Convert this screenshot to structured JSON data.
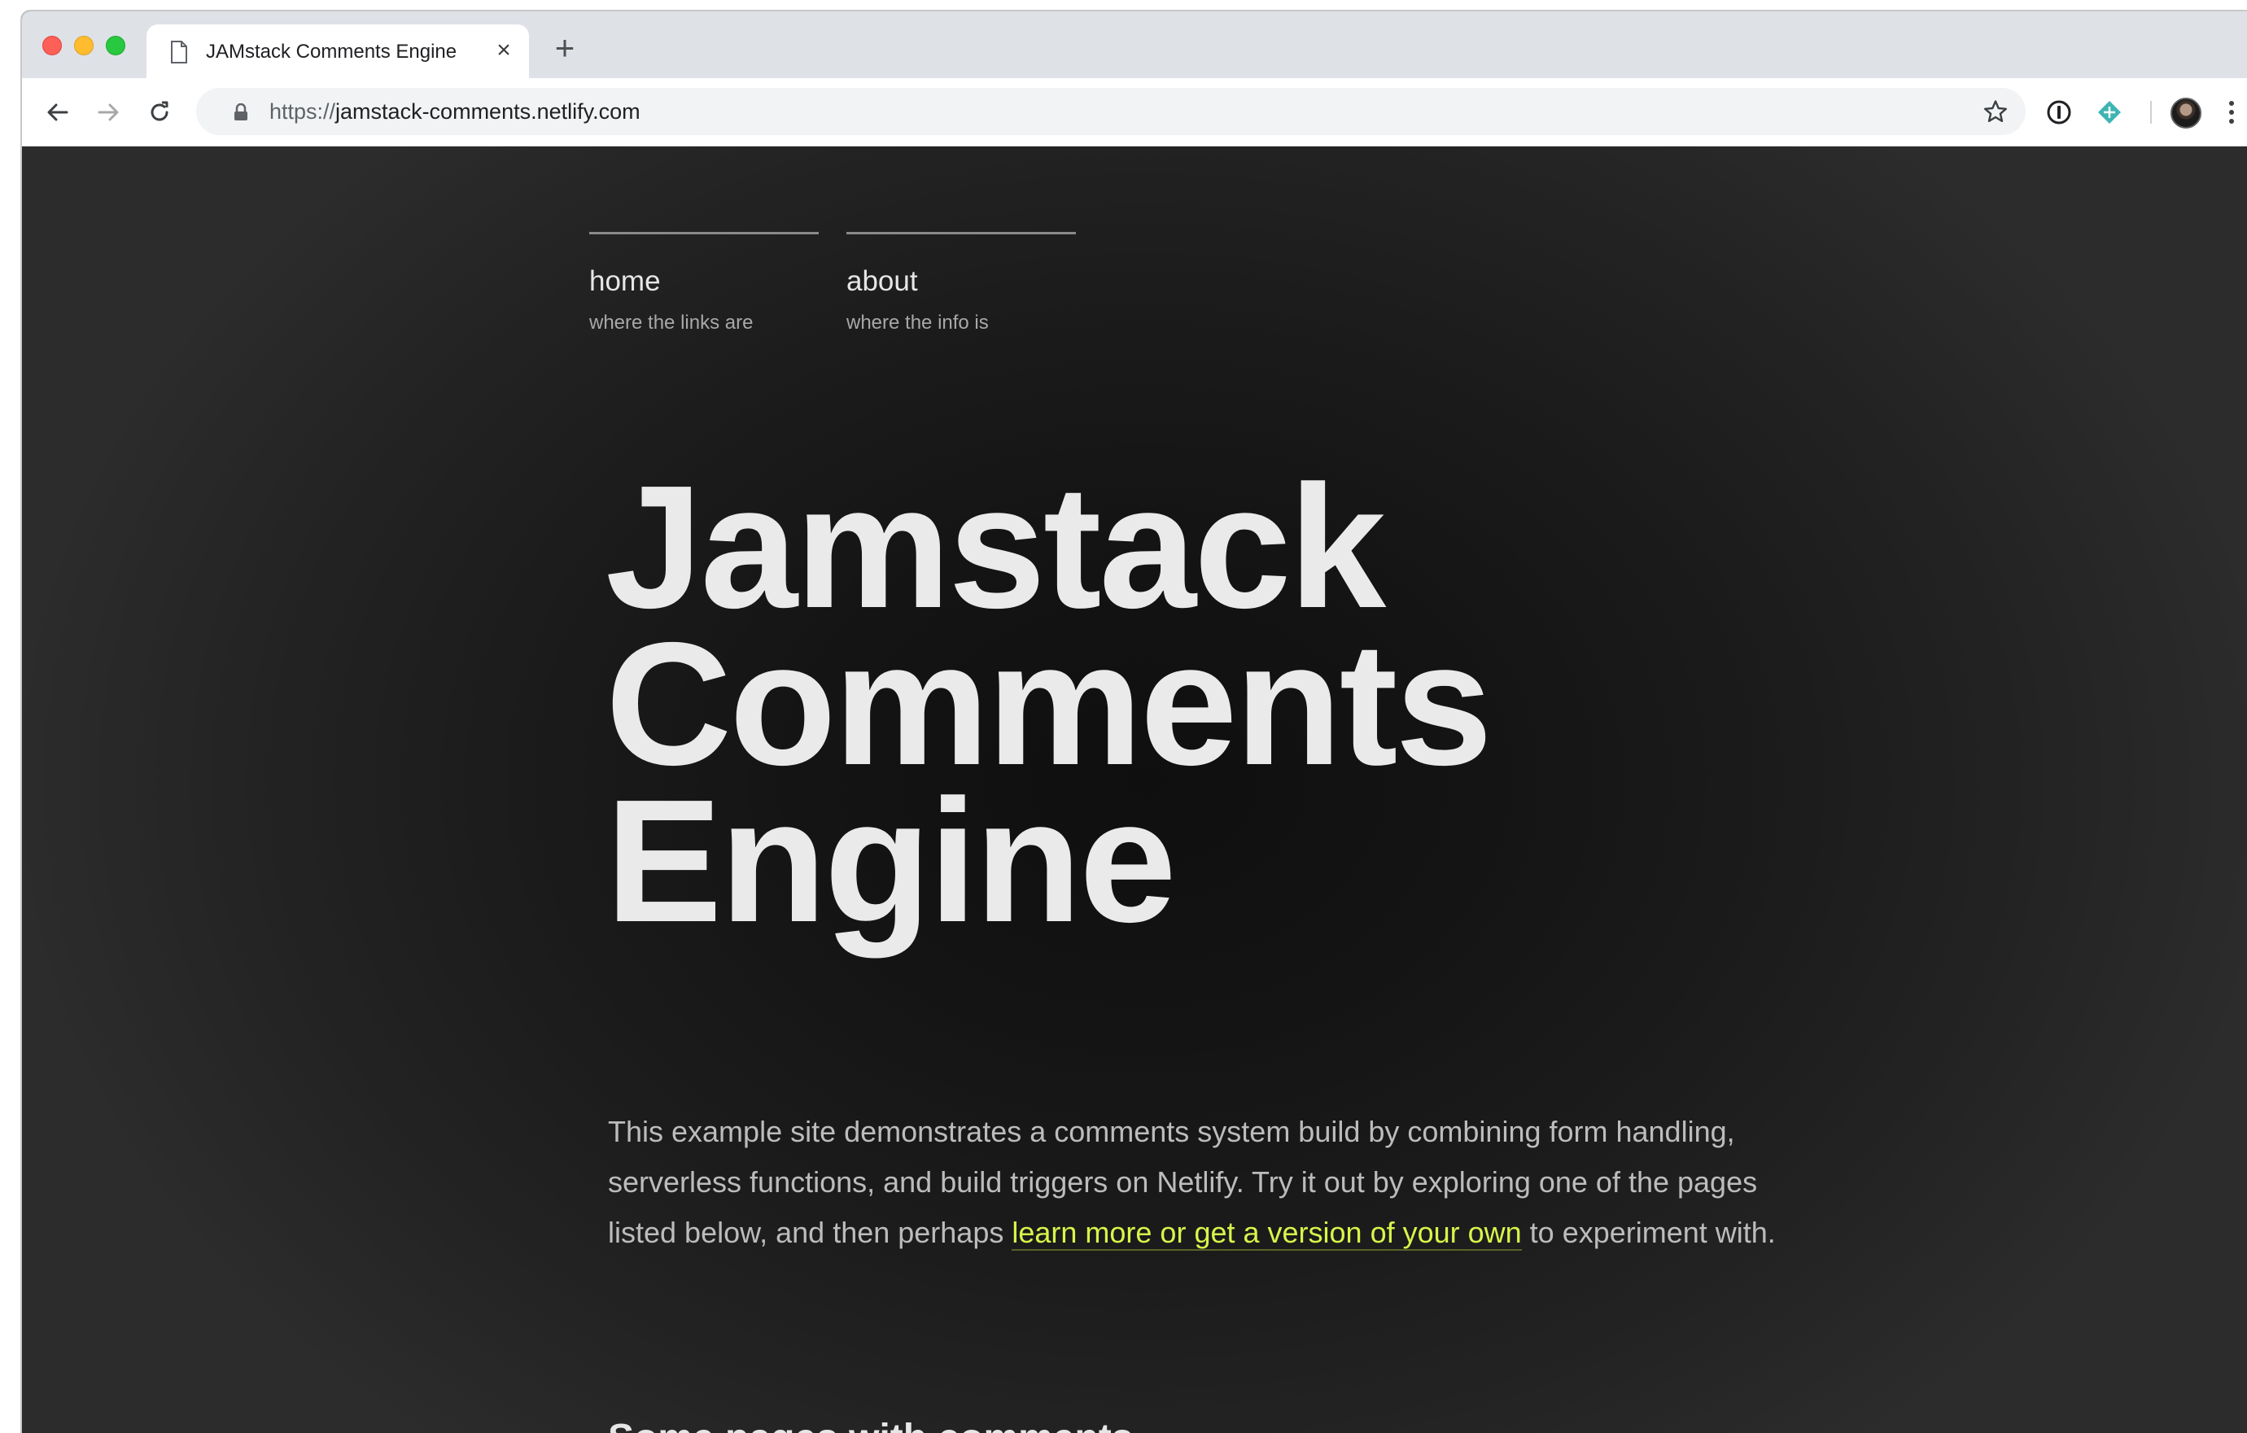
{
  "browser": {
    "tab": {
      "title": "JAMstack Comments Engine",
      "close_label": "×"
    },
    "new_tab_label": "+",
    "address_bar": {
      "scheme": "https://",
      "host": "jamstack-comments.netlify.com"
    },
    "icons": {
      "back": "back-arrow-icon",
      "forward": "forward-arrow-icon",
      "reload": "reload-icon",
      "lock": "lock-icon",
      "bookmark": "star-icon",
      "onepassword": "onepassword-extension-icon",
      "netlify": "netlify-extension-icon",
      "menu": "kebab-menu-icon"
    }
  },
  "page": {
    "nav": [
      {
        "title": "home",
        "subtitle": "where the links are"
      },
      {
        "title": "about",
        "subtitle": "where the info is"
      }
    ],
    "hero": {
      "line1": "Jamstack",
      "line2": "Comments",
      "line3": "Engine"
    },
    "intro": {
      "text_before": "This example site demonstrates a comments system build by combining form handling, serverless functions, and build triggers on Netlify. Try it out by exploring one of the pages listed below, and then perhaps ",
      "link_text": "learn more or get a version of your own",
      "text_after": " to experiment with."
    },
    "section_heading": "Some pages with comments"
  },
  "colors": {
    "page_background": "#1c1c1c",
    "link_accent": "#d7f54a",
    "heading_text": "#eaeaea",
    "body_text": "#bcbcbc"
  }
}
